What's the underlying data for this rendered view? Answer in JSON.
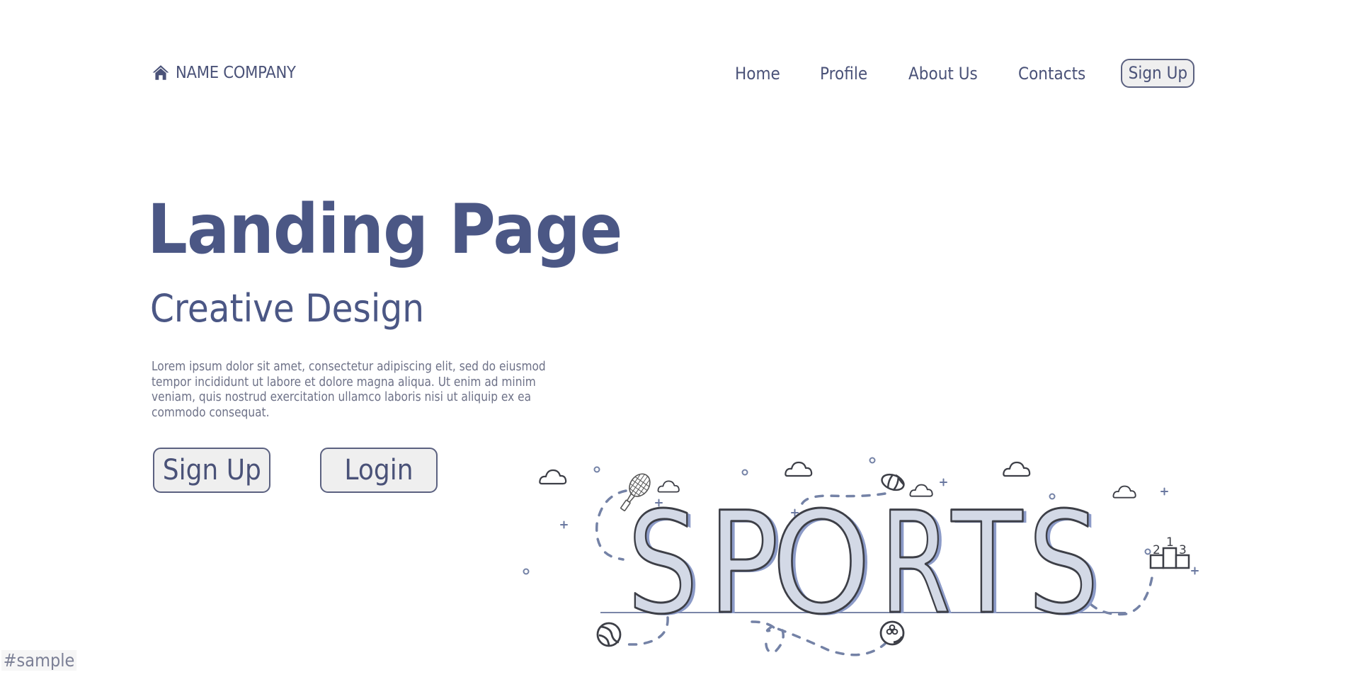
{
  "header": {
    "brand": {
      "icon": "home-icon",
      "name": "NAME COMPANY"
    },
    "nav": [
      {
        "label": "Home"
      },
      {
        "label": "Profile"
      },
      {
        "label": "About Us"
      },
      {
        "label": "Contacts"
      }
    ],
    "signup_label": "Sign Up"
  },
  "hero": {
    "title": "Landing Page",
    "subtitle": "Creative Design",
    "text": "Lorem ipsum dolor sit amet, consectetur adipiscing elit, sed do eiusmod tempor incididunt ut labore et dolore magna aliqua. Ut enim ad minim veniam, quis nostrud exercitation ullamco laboris nisi ut aliquip ex ea commodo consequat.",
    "buttons": {
      "signup": "Sign Up",
      "login": "Login"
    }
  },
  "illustration": {
    "word_letters": [
      "S",
      "P",
      "O",
      "R",
      "T",
      "S"
    ],
    "podium_labels": [
      "2",
      "1",
      "3"
    ],
    "icons": [
      "tennis-racket-icon",
      "american-football-icon",
      "tennis-ball-icon",
      "bowling-ball-icon",
      "podium-icon",
      "cloud-icon"
    ],
    "colors": {
      "letter_fill": "#d3d9e6",
      "letter_shadow": "#8c9bc8",
      "outline": "#3d3f47",
      "dash": "#7482a6",
      "accent_text": "#4b5785"
    }
  },
  "watermark": "#sample"
}
